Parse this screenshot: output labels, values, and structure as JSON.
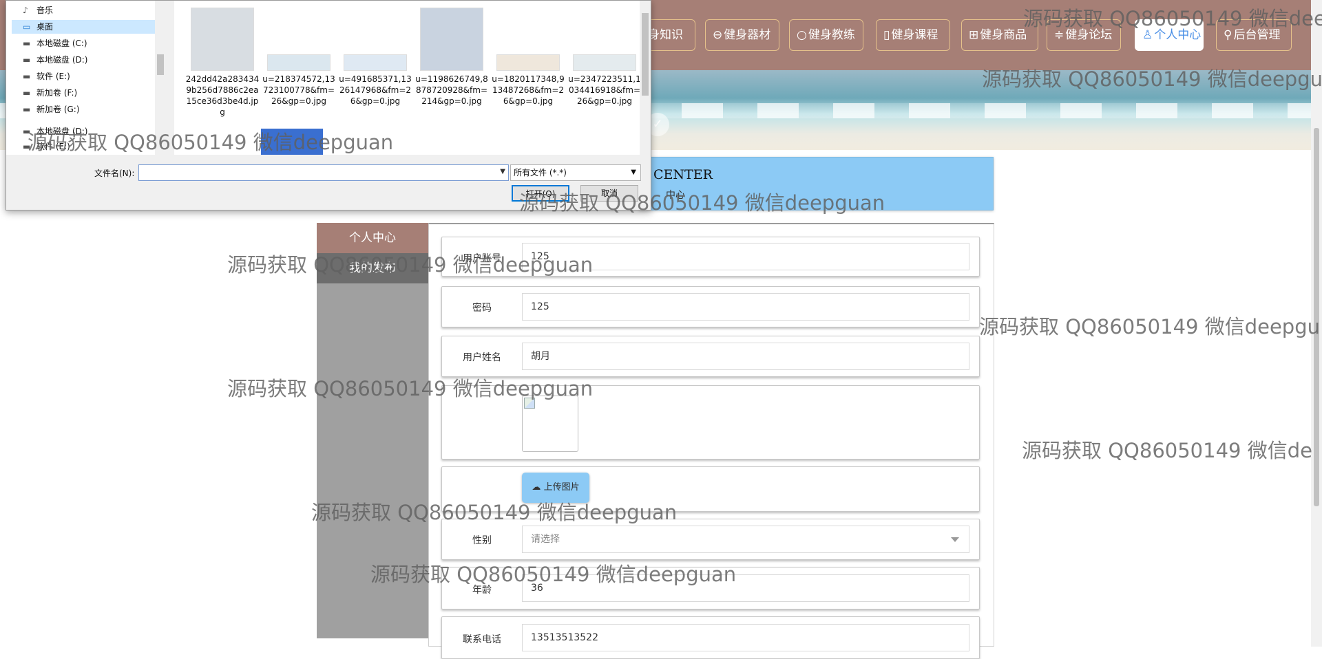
{
  "nav": {
    "items": [
      {
        "label": "身知识",
        "icon": ""
      },
      {
        "label": "健身器材",
        "icon": "⊖"
      },
      {
        "label": "健身教练",
        "icon": "○"
      },
      {
        "label": "健身课程",
        "icon": "▯"
      },
      {
        "label": "健身商品",
        "icon": "⊞"
      },
      {
        "label": "健身论坛",
        "icon": "≑"
      },
      {
        "label": "个人中心",
        "icon": "♙"
      },
      {
        "label": "后台管理",
        "icon": "⚲"
      }
    ]
  },
  "banner": {
    "indicator": "✓"
  },
  "title": {
    "en": "CENTER",
    "cn": "中心"
  },
  "side_menu": {
    "items": [
      "个人中心",
      "我的发布"
    ]
  },
  "form": {
    "account": {
      "label": "用户账号",
      "value": "125"
    },
    "password": {
      "label": "密码",
      "value": "125"
    },
    "name": {
      "label": "用户姓名",
      "value": "胡月"
    },
    "upload": {
      "label": "上传图片",
      "icon": "☁"
    },
    "gender": {
      "label": "性别",
      "placeholder": "请选择"
    },
    "age": {
      "label": "年龄",
      "value": "36"
    },
    "phone": {
      "label": "联系电话",
      "value": "13513513522"
    }
  },
  "dialog": {
    "tree": [
      {
        "icon": "♪",
        "label": "音乐"
      },
      {
        "icon": "▭",
        "label": "桌面",
        "selected": true
      },
      {
        "icon": "▬",
        "label": "本地磁盘 (C:)"
      },
      {
        "icon": "▬",
        "label": "本地磁盘 (D:)"
      },
      {
        "icon": "▬",
        "label": "软件 (E:)"
      },
      {
        "icon": "▬",
        "label": "新加卷 (F:)"
      },
      {
        "icon": "▬",
        "label": "新加卷 (G:)"
      },
      {
        "icon": "▬",
        "label": "本地磁盘 (D:)"
      },
      {
        "icon": "▬",
        "label": "软件 (E:)"
      }
    ],
    "files": [
      "242dd42a2834349b256d7886c2ea15ce36d3be4d.jpg",
      "u=218374572,13723100778&fm=26&gp=0.jpg",
      "u=491685371,1326147968&fm=26&gp=0.jpg",
      "u=1198626749,8878720928&fm=214&gp=0.jpg",
      "u=1820117348,913487268&fm=26&gp=0.jpg",
      "u=2347223511,1034416918&fm=26&gp=0.jpg"
    ],
    "filename_label": "文件名(N):",
    "filename_value": "",
    "filetype": "所有文件 (*.*)",
    "open_label": "打开(O)",
    "cancel_label": "取消"
  },
  "watermark": "源码获取 QQ86050149 微信deepguan",
  "watermark_cut": "源码获取 QQ86050149 微信de",
  "watermark_cut2": "源码获取 QQ86050149 微信deepgu",
  "watermark_cut3": "源码获取 QQ86050149 微信dee"
}
